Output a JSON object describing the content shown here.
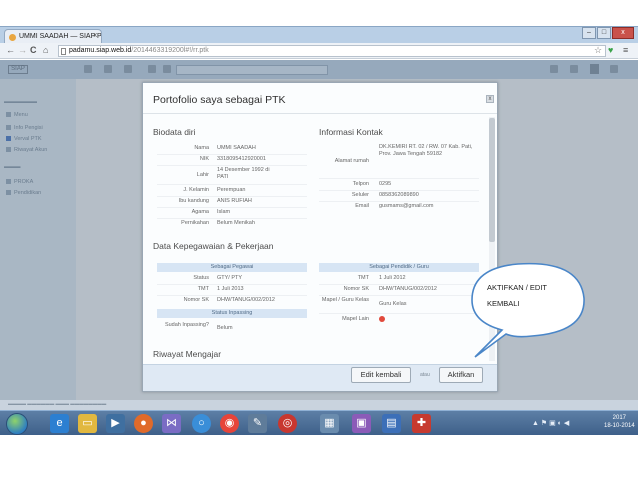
{
  "browser": {
    "tab_title": "UMMI SAADAH — SIAP P",
    "tab_close": "x",
    "url_domain": "padamu.siap.web.id",
    "url_rest": "/2014463319200l#!/rr.ptk",
    "win_min": "–",
    "win_max": "□",
    "win_close": "x"
  },
  "app": {
    "logo_text": "SIAP"
  },
  "sidebar": {
    "items": [
      "Menu",
      "Info Pengisi",
      "Verval PTK",
      "Riwayat Akun",
      "PROKA",
      "Pendidikan"
    ]
  },
  "modal": {
    "title": "Portofolio saya sebagai PTK",
    "close": "x",
    "biodata": {
      "heading": "Biodata diri",
      "fields": [
        {
          "label": "Nama",
          "value": "UMMI SAADAH"
        },
        {
          "label": "NIK",
          "value": "3318095412920001"
        },
        {
          "label": "Lahir",
          "value": "14 Desember 1992 di PATI"
        },
        {
          "label": "J. Kelamin",
          "value": "Perempuan"
        },
        {
          "label": "Ibu kandung",
          "value": "ANIS RUFIAH"
        },
        {
          "label": "Agama",
          "value": "Islam"
        },
        {
          "label": "Pernikahan",
          "value": "Belum Menikah"
        }
      ]
    },
    "kontak": {
      "heading": "Informasi Kontak",
      "fields": [
        {
          "label": "Alamat rumah",
          "value": "DK.KEMIRI RT. 02 / RW. 07 Kab. Pati, Prov. Jawa Tengah 59182"
        },
        {
          "label": "Telpon",
          "value": "0295"
        },
        {
          "label": "Seluler",
          "value": "0858362089890"
        },
        {
          "label": "Email",
          "value": "gusmams@gmail.com"
        }
      ]
    },
    "kepegawaian": {
      "heading": "Data Kepegawaian & Pekerjaan",
      "pegawai_header": "Sebagai Pegawai",
      "pegawai": [
        {
          "label": "Status",
          "value": "GTY/ PTY"
        },
        {
          "label": "TMT",
          "value": "1 Juli 2013"
        },
        {
          "label": "Nomor SK",
          "value": "DHW/TANUG/002/2012"
        }
      ],
      "inpassing_header": "Status Inpassing",
      "inpassing": [
        {
          "label": "Sudah Inpassing?",
          "value": "Belum"
        }
      ],
      "guru_header": "Sebagai Pendidik / Guru",
      "guru": [
        {
          "label": "TMT",
          "value": "1 Juli 2012"
        },
        {
          "label": "Nomor SK",
          "value": "DHW/TANUG/002/2012"
        },
        {
          "label": "Mapel / Guru Kelas",
          "value": "Guru Kelas"
        },
        {
          "label": "Mapel Lain",
          "value": ""
        }
      ]
    },
    "riwayat_heading": "Riwayat Mengajar",
    "footer": {
      "edit_label": "Edit kembali",
      "atau": "atau",
      "aktifkan_label": "Aktifkan"
    }
  },
  "annotation": {
    "line1": "AKTIFKAN / EDIT",
    "line2": "KEMBALI"
  },
  "taskbar": {
    "icons": [
      "internet-explorer-icon",
      "folder-icon",
      "media-icon",
      "firefox-icon",
      "music-icon",
      "chrome-alt-icon",
      "chrome-icon",
      "feather-icon",
      "bubble-icon",
      "calculator-icon",
      "slides-icon",
      "word-icon",
      "pdf-icon"
    ],
    "clock_time": "2017",
    "clock_date": "18-10-2014"
  }
}
